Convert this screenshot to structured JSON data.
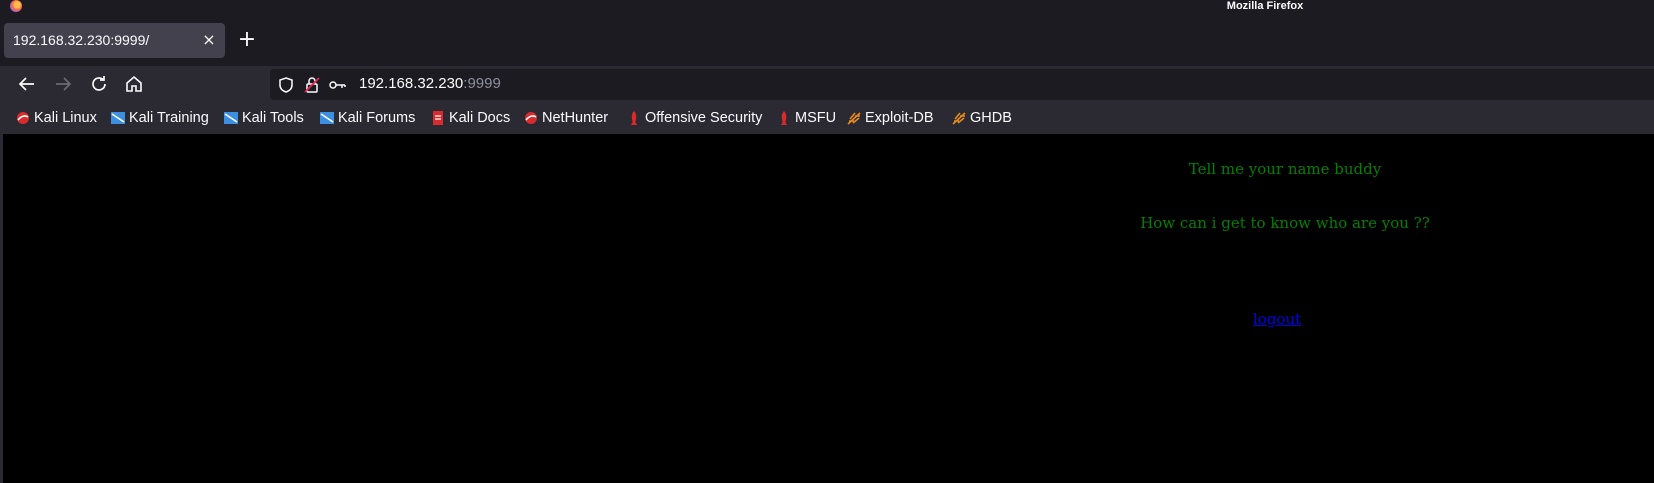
{
  "window": {
    "title": "Mozilla Firefox"
  },
  "tabs": [
    {
      "label": "192.168.32.230:9999/",
      "close_glyph": "×"
    }
  ],
  "newtab_glyph": "+",
  "urlbar": {
    "host": "192.168.32.230",
    "port": ":9999"
  },
  "bookmarks": [
    {
      "label": "Kali Linux",
      "icon": "kali-dragon-icon"
    },
    {
      "label": "Kali Training",
      "icon": "kali-training-icon"
    },
    {
      "label": "Kali Tools",
      "icon": "kali-tools-icon"
    },
    {
      "label": "Kali Forums",
      "icon": "kali-forums-icon"
    },
    {
      "label": "Kali Docs",
      "icon": "kali-docs-icon"
    },
    {
      "label": "NetHunter",
      "icon": "nethunter-icon"
    },
    {
      "label": "Offensive Security",
      "icon": "offsec-icon"
    },
    {
      "label": "MSFU",
      "icon": "msfu-icon"
    },
    {
      "label": "Exploit-DB",
      "icon": "exploit-db-icon"
    },
    {
      "label": "GHDB",
      "icon": "ghdb-icon"
    }
  ],
  "page": {
    "line1": "Tell me your name buddy",
    "line2": "How can i get to know who are you ??",
    "logout_label": "logout"
  },
  "colors": {
    "page_background": "#000000",
    "message_text": "#008000",
    "link": "#0000ee",
    "chrome_dark": "#1c1b22",
    "chrome_toolbar": "#2b2a33"
  }
}
